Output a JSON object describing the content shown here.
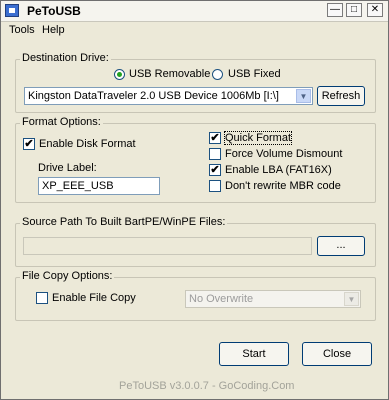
{
  "window": {
    "title": "PeToUSB"
  },
  "menu": {
    "items": [
      "Tools",
      "Help"
    ]
  },
  "destination": {
    "group_label": "Destination Drive:",
    "radio_removable": "USB Removable",
    "radio_fixed": "USB Fixed",
    "selected_radio": "USB Removable",
    "device_value": "Kingston DataTraveler 2.0 USB Device 1006Mb [I:\\]",
    "refresh_label": "Refresh"
  },
  "format": {
    "group_label": "Format Options:",
    "enable_disk_format": "Enable Disk Format",
    "enable_disk_format_checked": true,
    "quick_format": "Quick Format",
    "quick_format_checked": true,
    "force_dismount": "Force Volume Dismount",
    "force_dismount_checked": false,
    "enable_lba": "Enable LBA (FAT16X)",
    "enable_lba_checked": true,
    "dont_rewrite_mbr": "Don't rewrite MBR code",
    "dont_rewrite_mbr_checked": false,
    "drive_label_title": "Drive Label:",
    "drive_label_value": "XP_EEE_USB"
  },
  "source": {
    "group_label": "Source Path To Built BartPE/WinPE Files:",
    "path_value": "",
    "browse_label": "..."
  },
  "filecopy": {
    "group_label": "File Copy Options:",
    "enable_file_copy": "Enable File Copy",
    "enable_file_copy_checked": false,
    "overwrite_value": "No Overwrite"
  },
  "buttons": {
    "start": "Start",
    "close": "Close"
  },
  "footer": {
    "version": "PeToUSB v3.0.0.7 - GoCoding.Com"
  }
}
